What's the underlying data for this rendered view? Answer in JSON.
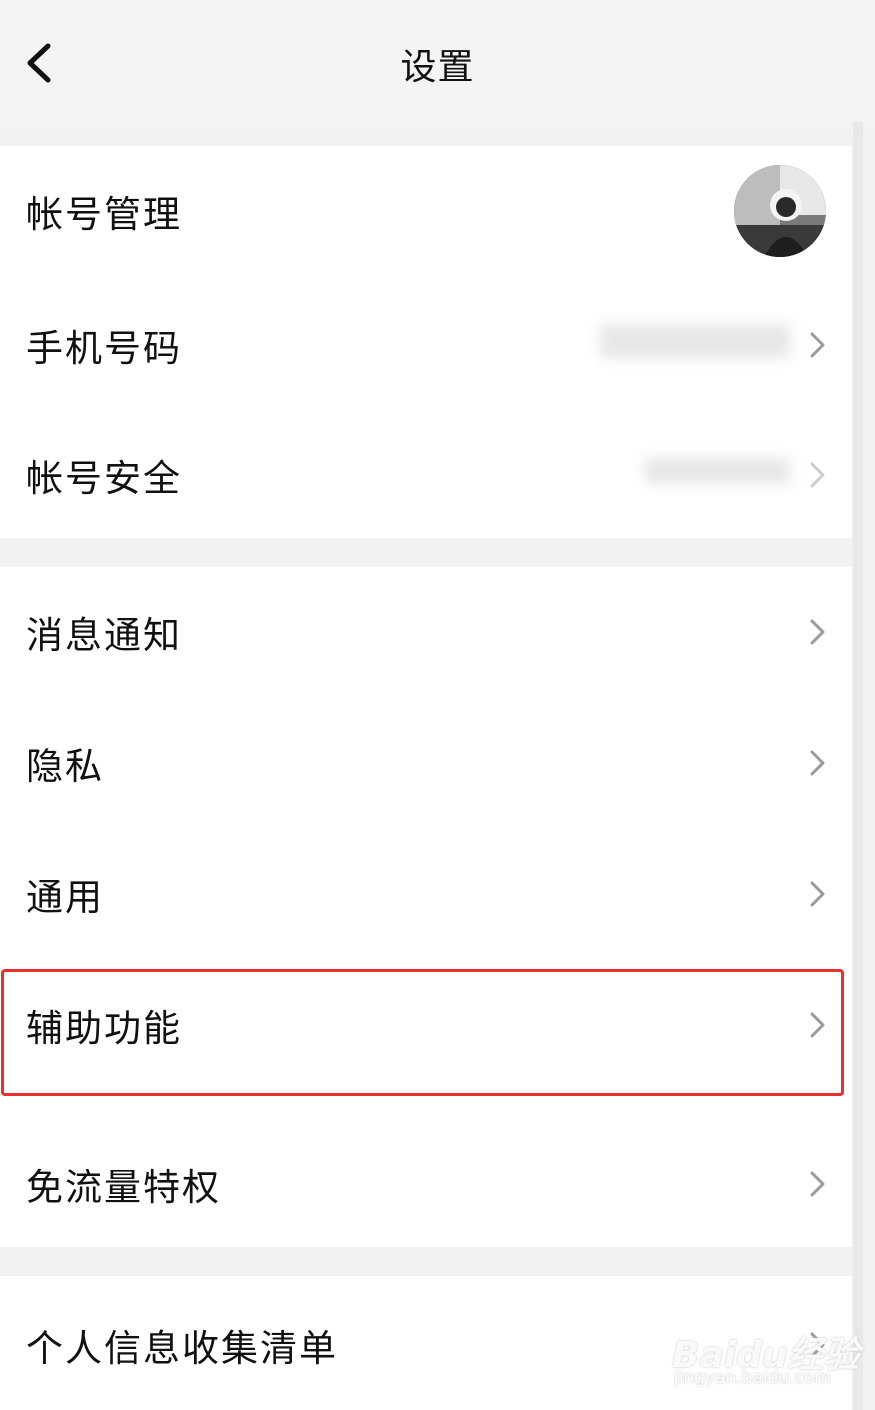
{
  "header": {
    "title": "设置",
    "back_icon": "chevron-left-icon"
  },
  "groups": [
    {
      "items": [
        {
          "label": "帐号管理",
          "trailing": "avatar"
        },
        {
          "label": "手机号码",
          "trailing": "chevron-right-icon"
        },
        {
          "label": "帐号安全",
          "trailing": "chevron-right-icon"
        }
      ]
    },
    {
      "items": [
        {
          "label": "消息通知",
          "trailing": "chevron-right-icon"
        },
        {
          "label": "隐私",
          "trailing": "chevron-right-icon"
        },
        {
          "label": "通用",
          "trailing": "chevron-right-icon"
        },
        {
          "label": "辅助功能",
          "trailing": "chevron-right-icon",
          "highlighted": true
        },
        {
          "label": "免流量特权",
          "trailing": "chevron-right-icon"
        }
      ]
    },
    {
      "items": [
        {
          "label": "个人信息收集清单",
          "trailing": "chevron-right-icon"
        }
      ]
    }
  ],
  "watermark": {
    "logo": "Baidu经验",
    "url": "jingyan.baidu.com"
  },
  "colors": {
    "background": "#f2f2f2",
    "row_background": "#ffffff",
    "text": "#111111",
    "chevron": "#9a9a9a",
    "highlight": "#e8302e"
  }
}
